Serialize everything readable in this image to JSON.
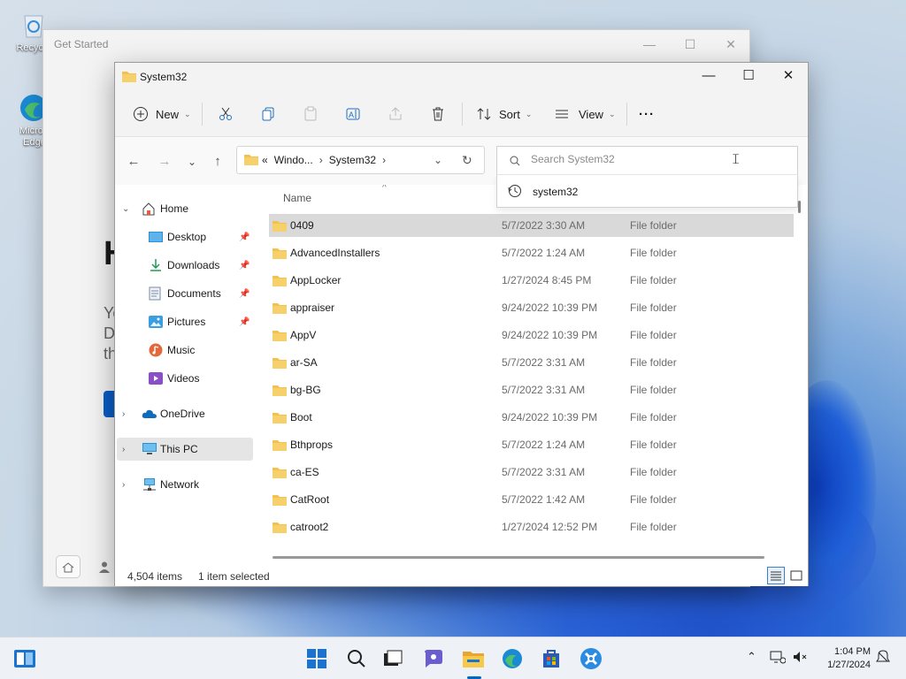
{
  "desktop": {
    "icons": [
      {
        "label": "Recycle",
        "icon": "recycle-bin-icon"
      },
      {
        "label": "Microsoft Edge",
        "icon": "edge-icon"
      }
    ]
  },
  "get_started": {
    "title": "Get Started",
    "heading": "H",
    "lines": [
      "Yo",
      "D",
      "th"
    ]
  },
  "explorer": {
    "title": "System32",
    "window_controls": {
      "minimize": "—",
      "maximize": "☐",
      "close": "✕"
    },
    "toolbar": {
      "new_label": "New",
      "sort_label": "Sort",
      "view_label": "View",
      "more_label": "···"
    },
    "address": {
      "prefix": "«",
      "crumbs": [
        "Windo...",
        "System32"
      ]
    },
    "search": {
      "placeholder": "Search System32",
      "suggestion": "system32"
    },
    "sidebar": {
      "items": [
        {
          "label": "Home",
          "icon": "home-icon"
        },
        {
          "label": "Desktop",
          "icon": "desktop-icon",
          "pinned": true
        },
        {
          "label": "Downloads",
          "icon": "downloads-icon",
          "pinned": true
        },
        {
          "label": "Documents",
          "icon": "documents-icon",
          "pinned": true
        },
        {
          "label": "Pictures",
          "icon": "pictures-icon",
          "pinned": true
        },
        {
          "label": "Music",
          "icon": "music-icon"
        },
        {
          "label": "Videos",
          "icon": "videos-icon"
        },
        {
          "label": "OneDrive",
          "icon": "onedrive-icon"
        },
        {
          "label": "This PC",
          "icon": "this-pc-icon"
        },
        {
          "label": "Network",
          "icon": "network-icon"
        }
      ]
    },
    "columns": {
      "name": "Name"
    },
    "files": [
      {
        "name": "0409",
        "date": "5/7/2022 3:30 AM",
        "type": "File folder"
      },
      {
        "name": "AdvancedInstallers",
        "date": "5/7/2022 1:24 AM",
        "type": "File folder"
      },
      {
        "name": "AppLocker",
        "date": "1/27/2024 8:45 PM",
        "type": "File folder"
      },
      {
        "name": "appraiser",
        "date": "9/24/2022 10:39 PM",
        "type": "File folder"
      },
      {
        "name": "AppV",
        "date": "9/24/2022 10:39 PM",
        "type": "File folder"
      },
      {
        "name": "ar-SA",
        "date": "5/7/2022 3:31 AM",
        "type": "File folder"
      },
      {
        "name": "bg-BG",
        "date": "5/7/2022 3:31 AM",
        "type": "File folder"
      },
      {
        "name": "Boot",
        "date": "9/24/2022 10:39 PM",
        "type": "File folder"
      },
      {
        "name": "Bthprops",
        "date": "5/7/2022 1:24 AM",
        "type": "File folder"
      },
      {
        "name": "ca-ES",
        "date": "5/7/2022 3:31 AM",
        "type": "File folder"
      },
      {
        "name": "CatRoot",
        "date": "5/7/2022 1:42 AM",
        "type": "File folder"
      },
      {
        "name": "catroot2",
        "date": "1/27/2024 12:52 PM",
        "type": "File folder"
      }
    ],
    "status": {
      "count": "4,504 items",
      "selected": "1 item selected"
    }
  },
  "taskbar": {
    "time": "1:04 PM",
    "date": "1/27/2024"
  },
  "colors": {
    "accent": "#0067c0",
    "folder": "#f2c14e",
    "selection": "#d9d9d9"
  }
}
